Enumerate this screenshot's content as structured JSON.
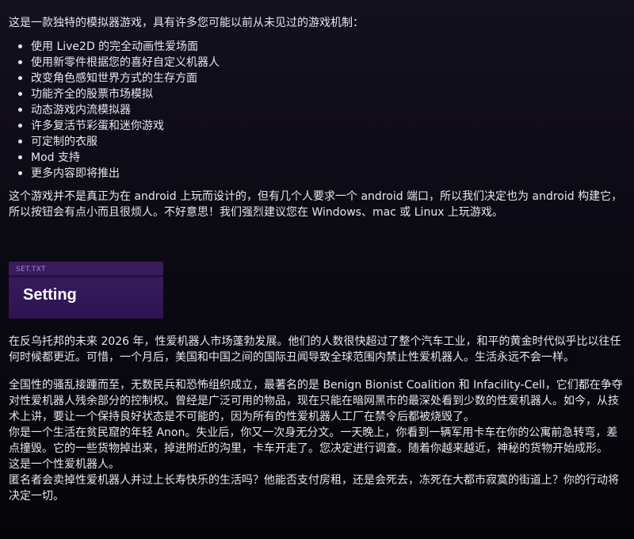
{
  "intro": "这是一款独特的模拟器游戏，具有许多您可能以前从未见过的游戏机制：",
  "features": [
    "使用 Live2D 的完全动画性爱场面",
    "使用新零件根据您的喜好自定义机器人",
    "改变角色感知世界方式的生存方面",
    "功能齐全的股票市场模拟",
    "动态游戏内流模拟器",
    "许多复活节彩蛋和迷你游戏",
    "可定制的衣服",
    "Mod 支持",
    "更多内容即将推出"
  ],
  "android_note": "这个游戏并不是真正为在 android 上玩而设计的，但有几个人要求一个 android 端口，所以我们决定也为 android 构建它，所以按钮会有点小而且很烦人。不好意思！我们强烈建议您在 Windows、mac 或 Linux 上玩游戏。",
  "banner": {
    "file_label": "SET.TXT",
    "title": "Setting"
  },
  "story": {
    "setting": "在反乌托邦的未来 2026 年，性爱机器人市场蓬勃发展。他们的人数很快超过了整个汽车工业，和平的黄金时代似乎比以往任何时候都更近。可惜，一个月后，美国和中国之间的国际丑闻导致全球范围内禁止性爱机器人。生活永远不会一样。",
    "chaos": "全国性的骚乱接踵而至，无数民兵和恐怖组织成立，最著名的是 Benign Bionist Coalition 和 Infacility-Cell，它们都在争夺对性爱机器人残余部分的控制权。曾经是广泛可用的物品，现在只能在暗网黑市的最深处看到少数的性爱机器人。如今，从技术上讲，要让一个保持良好状态是不可能的，因为所有的性爱机器人工厂在禁令后都被烧毁了。",
    "anon": "你是一个生活在贫民窟的年轻 Anon。失业后，你又一次身无分文。一天晚上，你看到一辆军用卡车在你的公寓前急转弯，差点撞毁。它的一些货物掉出来，掉进附近的沟里，卡车开走了。您决定进行调查。随着你越来越近，神秘的货物开始成形。",
    "reveal": "这是一个性爱机器人。",
    "question": "匿名者会卖掉性爱机器人并过上长寿快乐的生活吗？他能否支付房租，还是会死去，冻死在大都市寂寞的街道上？你的行动将决定一切。"
  }
}
